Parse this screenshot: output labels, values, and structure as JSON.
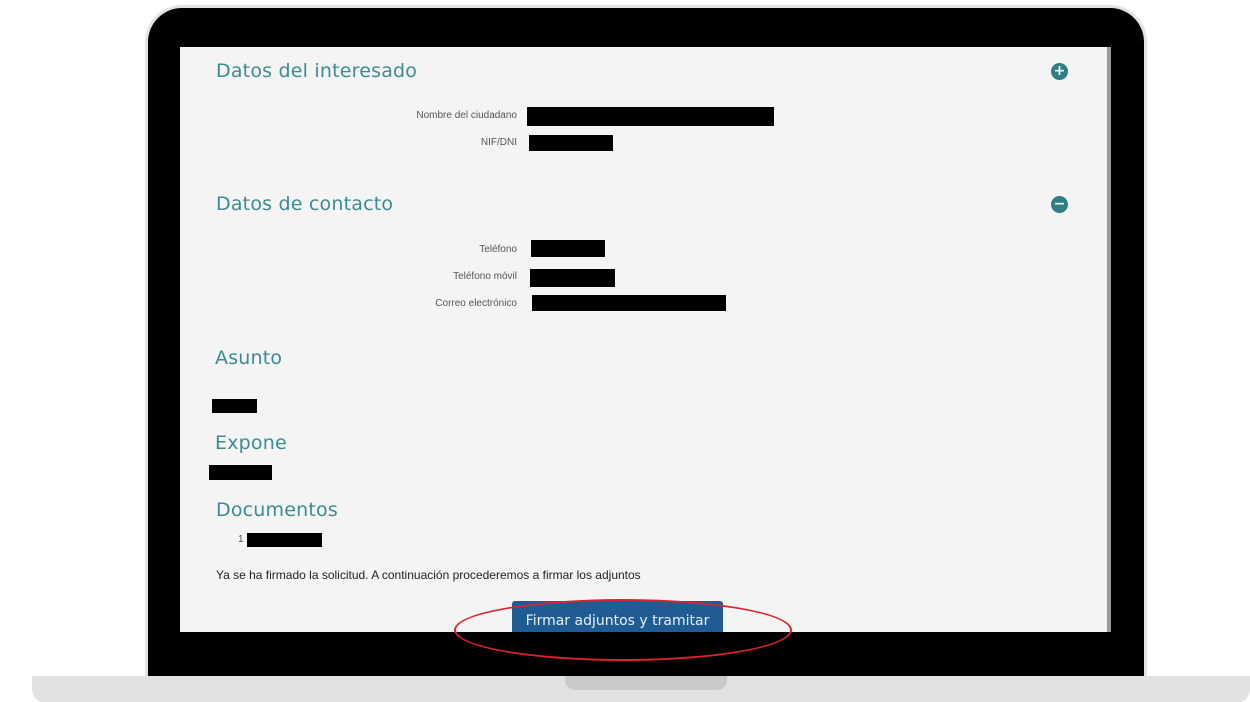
{
  "sections": {
    "interesado": {
      "title": "Datos del interesado",
      "toggle": "+",
      "fields": [
        {
          "label": "Nombre del ciudadano"
        },
        {
          "label": "NIF/DNI"
        }
      ]
    },
    "contacto": {
      "title": "Datos de contacto",
      "toggle": "−",
      "fields": [
        {
          "label": "Teléfono"
        },
        {
          "label": "Teléfono móvil"
        },
        {
          "label": "Correo electrónico"
        }
      ]
    },
    "asunto": {
      "title": "Asunto"
    },
    "expone": {
      "title": "Expone"
    },
    "documentos": {
      "title": "Documentos",
      "items": [
        {
          "number": "1"
        }
      ]
    }
  },
  "status_message": "Ya se ha firmado la solicitud. A continuación procederemos a firmar los adjuntos",
  "action": {
    "button_label": "Firmar adjuntos y tramitar"
  },
  "colors": {
    "heading": "#3a8c94",
    "toggle": "#2f7e85",
    "button": "#1f5c94",
    "highlight": "#d9242d",
    "redaction": "#000000"
  },
  "icons": {
    "expand": "plus-circle-icon",
    "collapse": "minus-circle-icon"
  }
}
